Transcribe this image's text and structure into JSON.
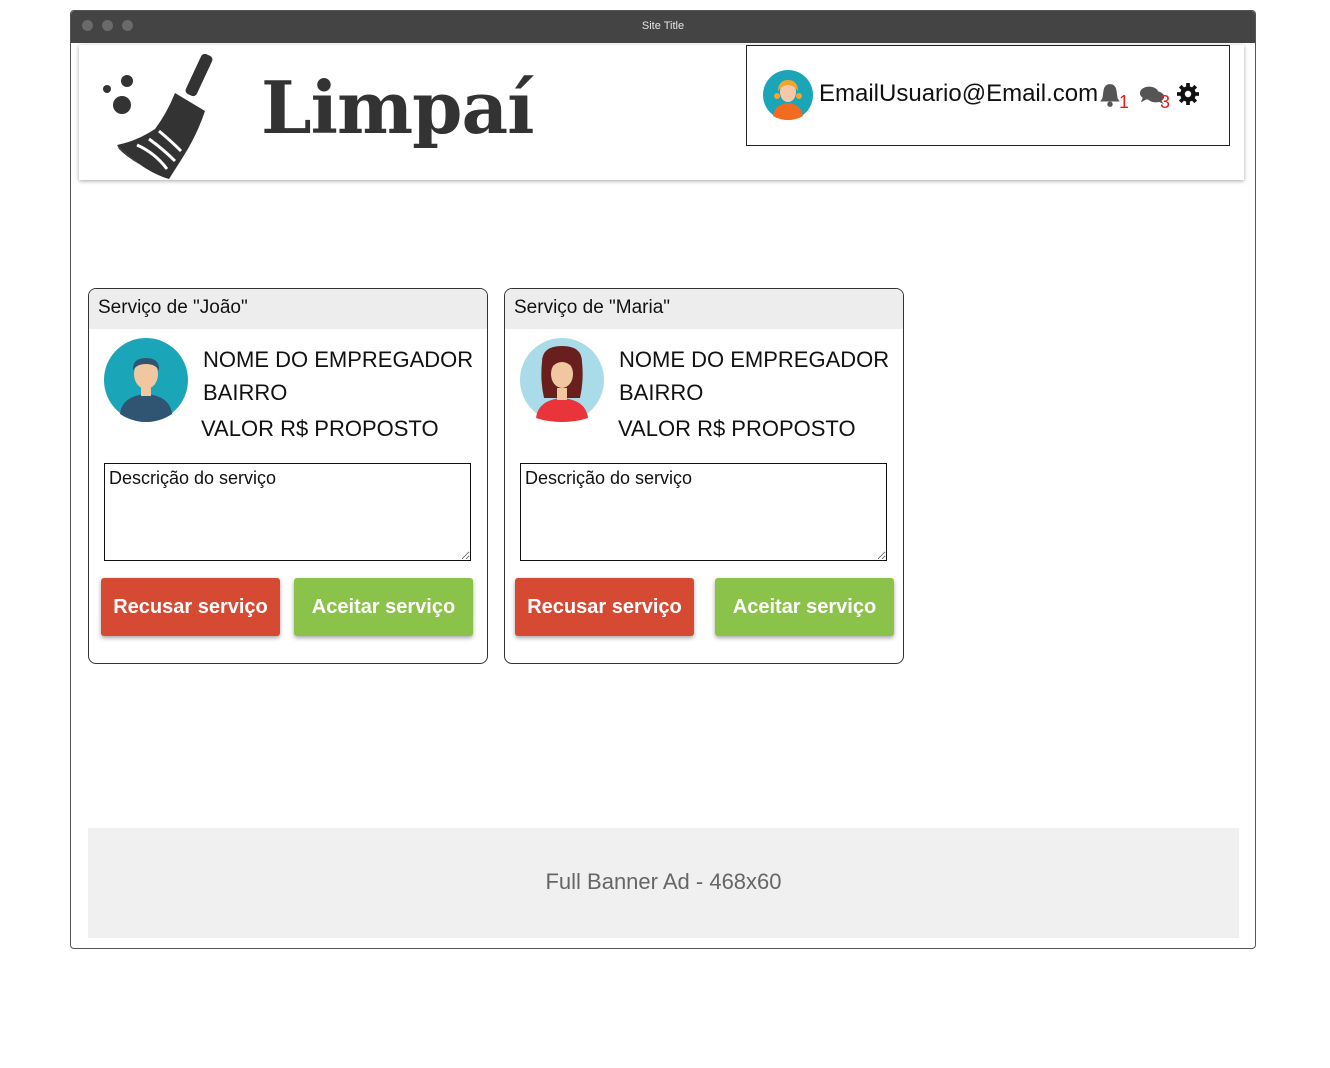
{
  "window": {
    "title": "Site Title"
  },
  "header": {
    "brand": "Limpaí",
    "user": {
      "email": "EmailUsuario@Email.com",
      "notifications_count": "1",
      "messages_count": "3",
      "icons": [
        "user-avatar",
        "bell-icon",
        "chat-icon",
        "gear-icon"
      ]
    }
  },
  "cards": [
    {
      "title": "Serviço de \"João\"",
      "employer_name": "NOME DO EMPREGADOR",
      "neighborhood": "BAIRRO",
      "proposed_value": "VALOR R$ PROPOSTO",
      "description": "Descrição do serviço",
      "refuse_label": "Recusar serviço",
      "accept_label": "Aceitar serviço",
      "avatar": "male-avatar"
    },
    {
      "title": "Serviço de \"Maria\"",
      "employer_name": "NOME DO EMPREGADOR",
      "neighborhood": "BAIRRO",
      "proposed_value": "VALOR R$ PROPOSTO",
      "description": "Descrição do serviço",
      "refuse_label": "Recusar serviço",
      "accept_label": "Aceitar serviço",
      "avatar": "female-avatar"
    }
  ],
  "banner": {
    "text": "Full Banner Ad - 468x60"
  },
  "colors": {
    "refuse": "#d64a34",
    "accept": "#8bc34a",
    "badge": "#e02020",
    "titlebar": "#444444"
  }
}
